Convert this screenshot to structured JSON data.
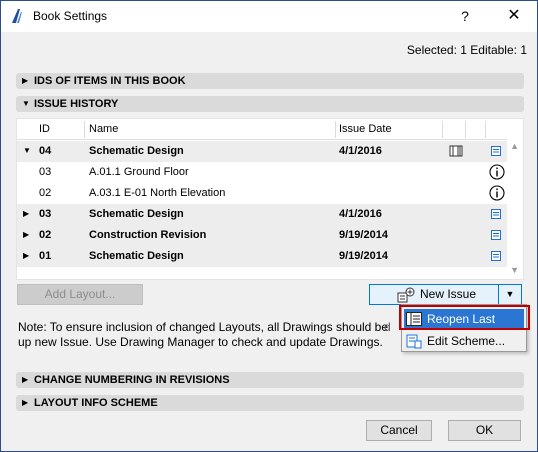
{
  "window": {
    "title": "Book Settings",
    "help_label": "?",
    "close_label": "✕"
  },
  "selected_info": "Selected: 1 Editable: 1",
  "sections": {
    "ids": "IDS OF ITEMS IN THIS BOOK",
    "issue_history": "ISSUE HISTORY",
    "change_numbering": "CHANGE NUMBERING IN REVISIONS",
    "layout_info": "LAYOUT INFO SCHEME"
  },
  "table": {
    "headers": {
      "id": "ID",
      "name": "Name",
      "date": "Issue Date"
    },
    "rows": [
      {
        "id": "04",
        "name": "Schematic Design",
        "date": "4/1/2016"
      },
      {
        "id": "03",
        "name": "A.01.1 Ground Floor",
        "date": ""
      },
      {
        "id": "02",
        "name": "A.03.1 E-01 North Elevation",
        "date": ""
      },
      {
        "id": "03",
        "name": "Schematic Design",
        "date": "4/1/2016"
      },
      {
        "id": "02",
        "name": "Construction Revision",
        "date": "9/19/2014"
      },
      {
        "id": "01",
        "name": "Schematic Design",
        "date": "9/19/2014"
      }
    ]
  },
  "buttons": {
    "add_layout": "Add Layout...",
    "new_issue": "New Issue",
    "cancel": "Cancel",
    "ok": "OK"
  },
  "note": {
    "text": "Note: To ensure inclusion of changed Layouts, all Drawings should be up new Issue. Use Drawing Manager to check and update Drawings.",
    "tail": "d"
  },
  "menu": {
    "reopen": "Reopen Last Issue",
    "edit_scheme": "Edit Scheme..."
  },
  "colors": {
    "highlight": "#2a76d2",
    "callout_border": "#c00000",
    "doc_icon": "#1e6fd9"
  }
}
